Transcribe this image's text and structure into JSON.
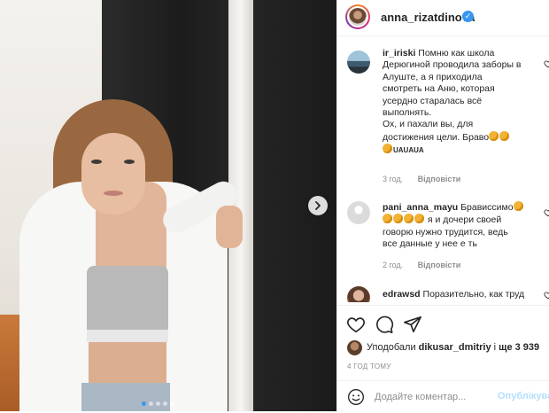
{
  "post": {
    "username": "anna_rizatdinova",
    "verified_badge": "✓",
    "carousel": {
      "total_slides": 5,
      "active_slide": 1
    }
  },
  "comments": [
    {
      "username": "ir_iriski",
      "text": "Помню как школа Дерюгиной проводила заборы в Алуште, а я приходила смотреть на Аню, которая усердно старалась всё выполнять.\nОх, и пахали вы, для достижения цели. Браво",
      "text_after_emoji": "👏👏",
      "tail": "UAUAUA",
      "time": "3 год.",
      "reply": "Відповісти"
    },
    {
      "username": "pani_anna_mayu",
      "text": "Брависсимо",
      "text_cont": "я и дочери своей говорю нужно трудится, ведь все данные у нее е ть",
      "time": "2 год.",
      "reply": "Відповісти"
    },
    {
      "username": "edrawsd",
      "text": "Поразительно, как труд"
    }
  ],
  "likes": {
    "prefix": "Уподобали",
    "user": "dikusar_dmitriy",
    "connector": "і",
    "more_label": "ще 3 939"
  },
  "timestamp": "4 ГОД ТОМУ",
  "add_comment": {
    "placeholder": "Додайте коментар...",
    "post_label": "Опублікувати"
  },
  "icons": {
    "heart": "heart-icon",
    "comment": "comment-icon",
    "share": "share-icon",
    "emoji": "emoji-icon",
    "next": "chevron-right-icon"
  },
  "colors": {
    "accent": "#3897f0",
    "post_disabled": "#b2dffc",
    "meta_text": "#8e8e8e"
  }
}
